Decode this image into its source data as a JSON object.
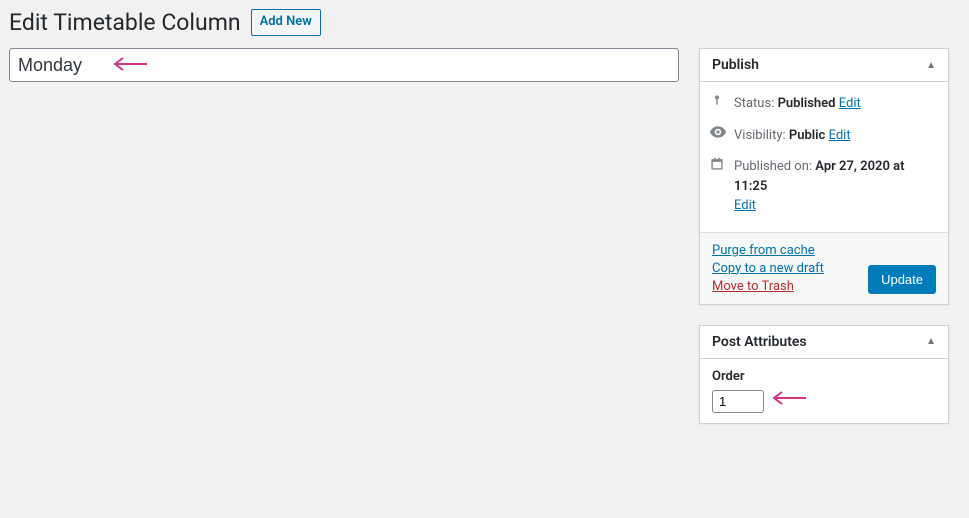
{
  "header": {
    "title": "Edit Timetable Column",
    "add_new": "Add New"
  },
  "post": {
    "title_value": "Monday"
  },
  "publish": {
    "box_title": "Publish",
    "status_label": "Status:",
    "status_value": "Published",
    "status_edit": "Edit",
    "visibility_label": "Visibility:",
    "visibility_value": "Public",
    "visibility_edit": "Edit",
    "published_label": "Published on:",
    "published_value": "Apr 27, 2020 at 11:25",
    "published_edit": "Edit",
    "purge_label": "Purge from cache",
    "copy_label": "Copy to a new draft",
    "trash_label": "Move to Trash",
    "update_label": "Update"
  },
  "attributes": {
    "box_title": "Post Attributes",
    "order_label": "Order",
    "order_value": "1"
  }
}
